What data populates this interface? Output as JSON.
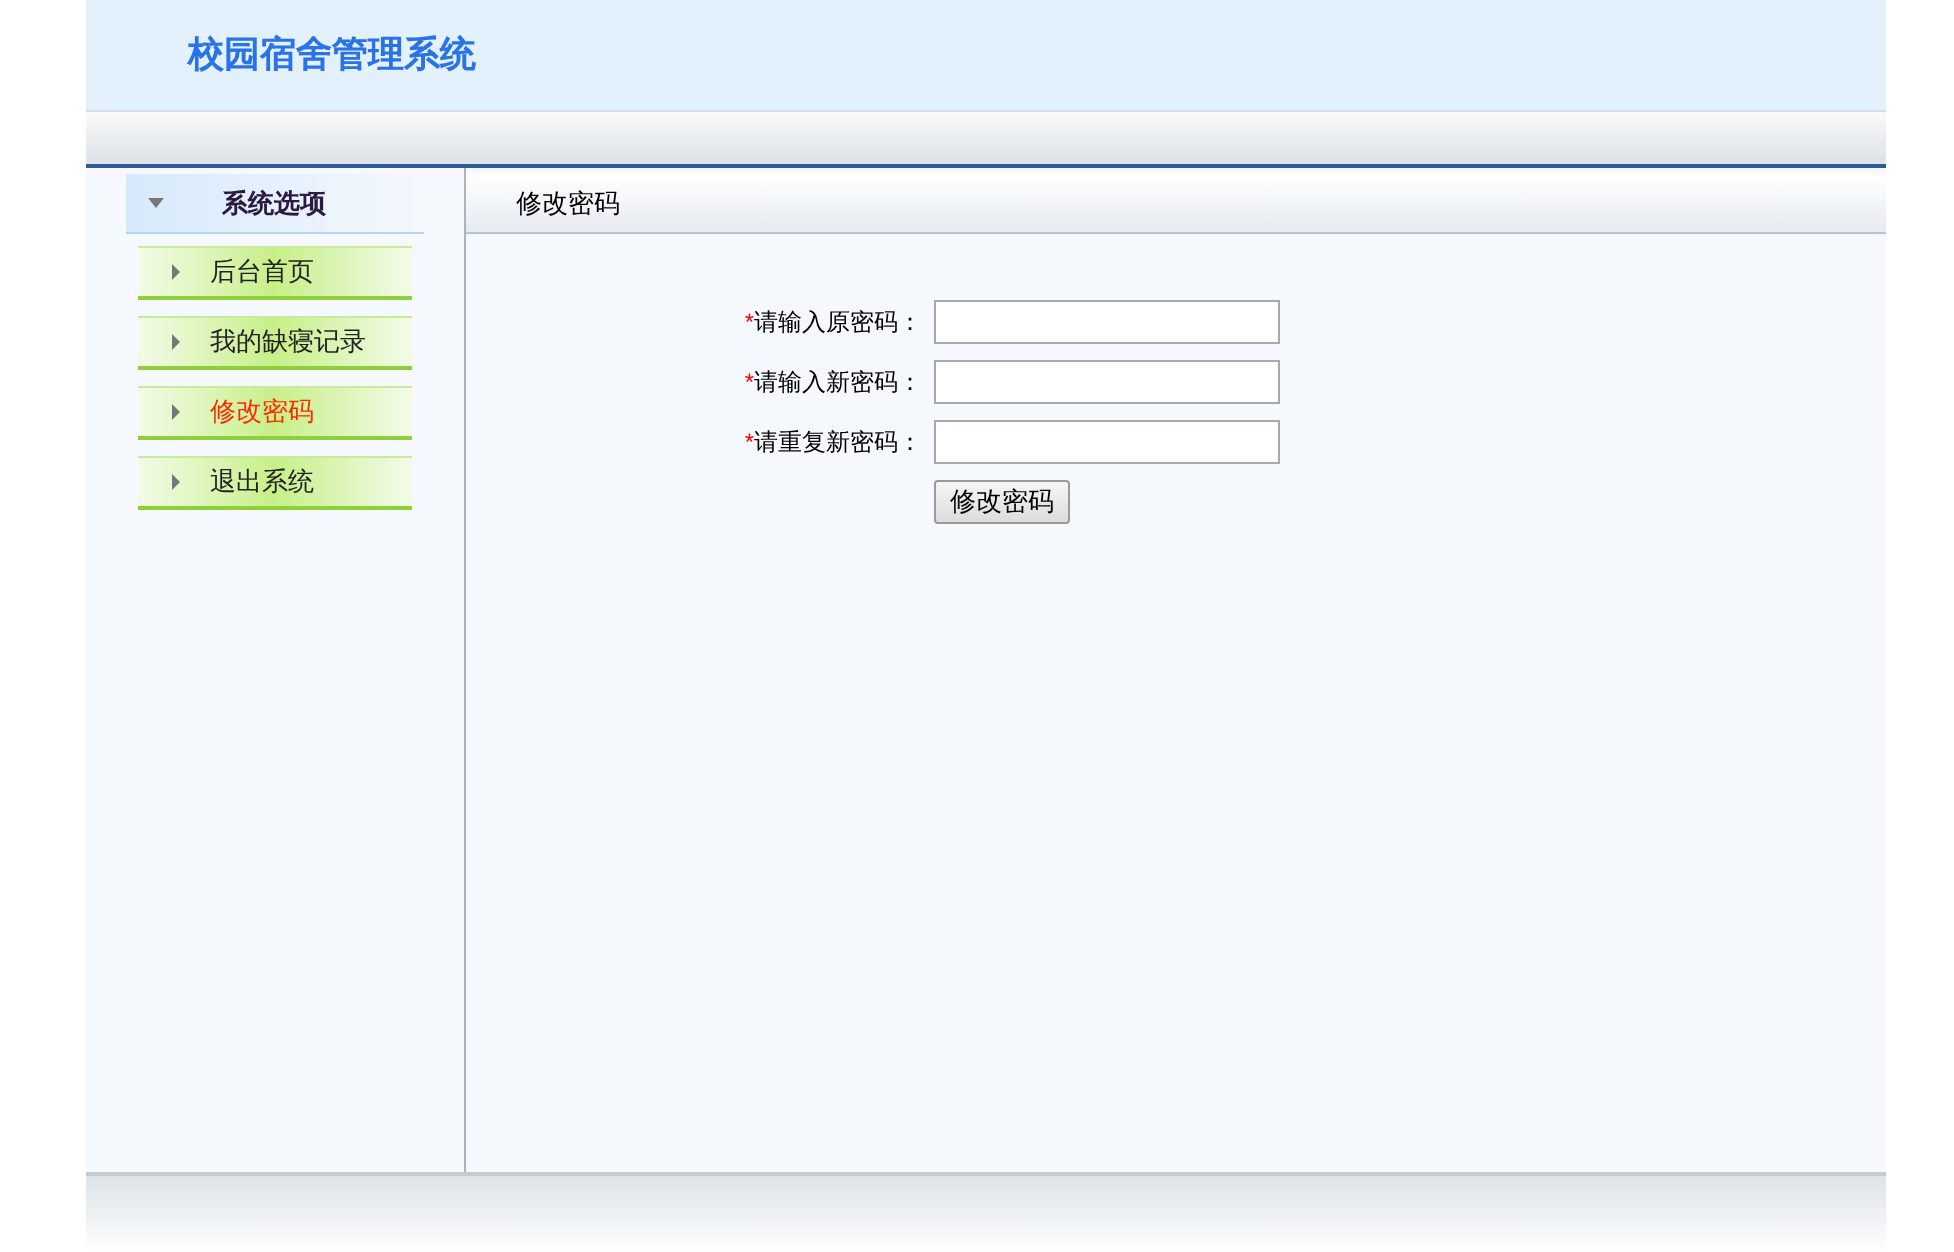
{
  "header": {
    "title": "校园宿舍管理系统"
  },
  "sidebar": {
    "title": "系统选项",
    "items": [
      {
        "label": "后台首页",
        "selected": false
      },
      {
        "label": "我的缺寝记录",
        "selected": false
      },
      {
        "label": "修改密码",
        "selected": true
      },
      {
        "label": "退出系统",
        "selected": false
      }
    ]
  },
  "content": {
    "title": "修改密码",
    "fields": [
      {
        "mark": "*",
        "label": "请输入原密码："
      },
      {
        "mark": "*",
        "label": "请输入新密码："
      },
      {
        "mark": "*",
        "label": "请重复新密码："
      }
    ],
    "submit": "修改密码"
  }
}
